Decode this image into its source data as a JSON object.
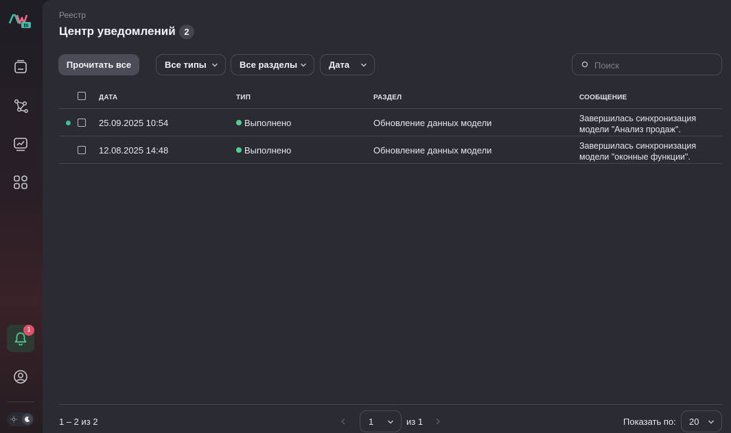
{
  "sidebar": {
    "logo_text": "BI",
    "icons": [
      "registry-icon",
      "graph-icon",
      "dashboard-chart-icon",
      "apps-grid-icon"
    ],
    "notifications_badge": "1",
    "colors": {
      "accent": "#4fd08c",
      "badge": "#e0506a"
    }
  },
  "header": {
    "breadcrumb": "Реестр",
    "title": "Центр уведомлений",
    "count": "2"
  },
  "toolbar": {
    "read_all_label": "Прочитать все",
    "filter_types_label": "Все типы",
    "filter_sections_label": "Все разделы",
    "filter_date_label": "Дата",
    "search_placeholder": "Поиск",
    "search_value": ""
  },
  "table": {
    "columns": [
      "ДАТА",
      "ТИП",
      "РАЗДЕЛ",
      "СООБЩЕНИЕ"
    ],
    "rows": [
      {
        "unread": true,
        "date": "25.09.2025 10:54",
        "type": "Выполнено",
        "section": "Обновление данных модели",
        "message": "Завершилась синхронизация модели \"Анализ продаж\"."
      },
      {
        "unread": false,
        "date": "12.08.2025 14:48",
        "type": "Выполнено",
        "section": "Обновление данных модели",
        "message": "Завершилась синхронизация модели \"оконные функции\"."
      }
    ]
  },
  "footer": {
    "range_text": "1 – 2 из 2",
    "current_page": "1",
    "of_pages": "из 1",
    "page_size_label": "Показать по:",
    "page_size": "20"
  }
}
